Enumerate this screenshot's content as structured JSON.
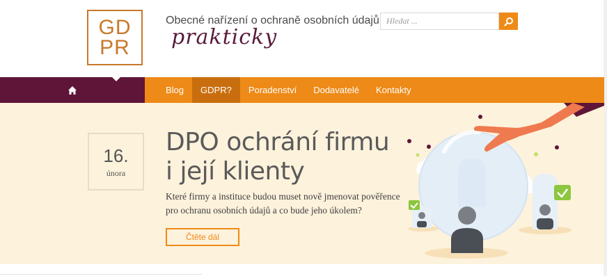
{
  "logo": {
    "line1": "GD",
    "line2": "PR"
  },
  "tagline": "Obecné nařízení o ochraně osobních údajů",
  "tagline_script": "prakticky",
  "search": {
    "placeholder": "Hledat ..."
  },
  "nav": {
    "items": [
      {
        "label": "Blog"
      },
      {
        "label": "GDPR?"
      },
      {
        "label": "Poradenství"
      },
      {
        "label": "Dodavatelé"
      },
      {
        "label": "Kontakty"
      }
    ]
  },
  "hero": {
    "date_day": "16.",
    "date_month": "února",
    "title": "DPO ochrání firmu i její klienty",
    "excerpt": "Které firmy a instituce budou muset nově jmenovat pověřence pro ochranu osobních údajů a co bude jeho úkolem?",
    "button_label": "Čtěte dál"
  },
  "colors": {
    "accent": "#ee8a17",
    "brand_dark": "#5f1538",
    "hero_bg": "#fdf2dc",
    "logo": "#c8782a"
  }
}
